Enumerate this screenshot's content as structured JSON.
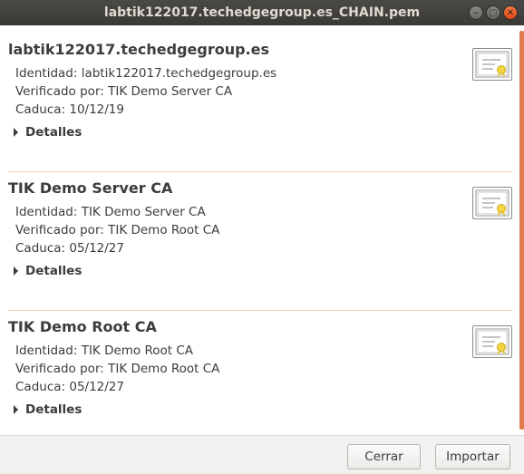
{
  "window": {
    "title": "labtik122017.techedgegroup.es_CHAIN.pem"
  },
  "certificates": [
    {
      "name": "labtik122017.techedgegroup.es",
      "identity": "Identidad: labtik122017.techedgegroup.es",
      "verified_by": "Verificado por: TIK Demo Server CA",
      "expires": "Caduca: 10/12/19",
      "details_label": "Detalles"
    },
    {
      "name": "TIK Demo Server CA",
      "identity": "Identidad: TIK Demo Server CA",
      "verified_by": "Verificado por: TIK Demo Root CA",
      "expires": "Caduca: 05/12/27",
      "details_label": "Detalles"
    },
    {
      "name": "TIK Demo Root CA",
      "identity": "Identidad: TIK Demo Root CA",
      "verified_by": "Verificado por: TIK Demo Root CA",
      "expires": "Caduca: 05/12/27",
      "details_label": "Detalles"
    }
  ],
  "footer": {
    "close_label": "Cerrar",
    "import_label": "Importar"
  },
  "colors": {
    "accent": "#e07a4a",
    "titlebar": "#3c3b37",
    "close_button": "#df4a16"
  },
  "icons": {
    "certificate": "certificate-icon",
    "expander": "expander-triangle-icon"
  }
}
